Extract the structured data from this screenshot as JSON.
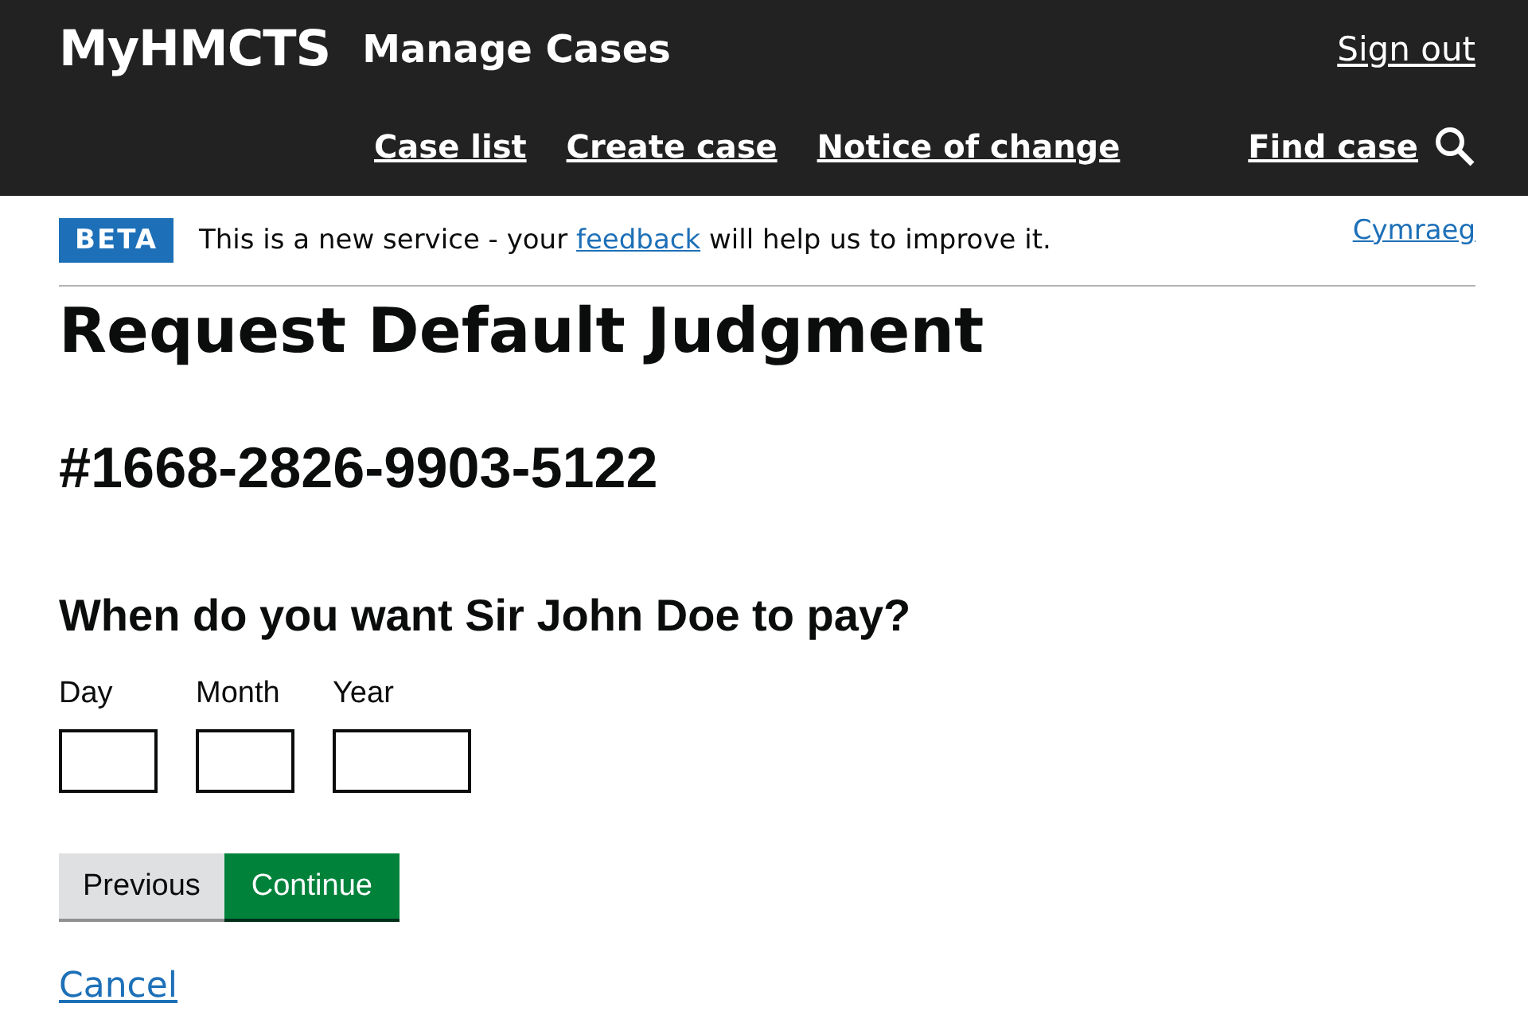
{
  "header": {
    "logo": "MyHMCTS",
    "service": "Manage Cases",
    "sign_out": "Sign out",
    "nav": [
      {
        "label": "Case list"
      },
      {
        "label": "Create case"
      },
      {
        "label": "Notice of change"
      }
    ],
    "find_case": "Find case"
  },
  "banner": {
    "tag": "BETA",
    "text_before": "This is a new service - your ",
    "link": "feedback",
    "text_after": " will help us to improve it.",
    "language": "Cymraeg"
  },
  "title": "Request Default Judgment",
  "case_number": "#1668-2826-9903-5122",
  "question": "When do you want Sir John Doe to pay?",
  "date_fields": [
    {
      "label": "Day",
      "kind": "short"
    },
    {
      "label": "Month",
      "kind": "short"
    },
    {
      "label": "Year",
      "kind": "long"
    }
  ],
  "buttons": [
    {
      "label": "Previous",
      "kind": "secondary"
    },
    {
      "label": "Continue",
      "kind": "primary"
    }
  ],
  "cancel": "Cancel"
}
